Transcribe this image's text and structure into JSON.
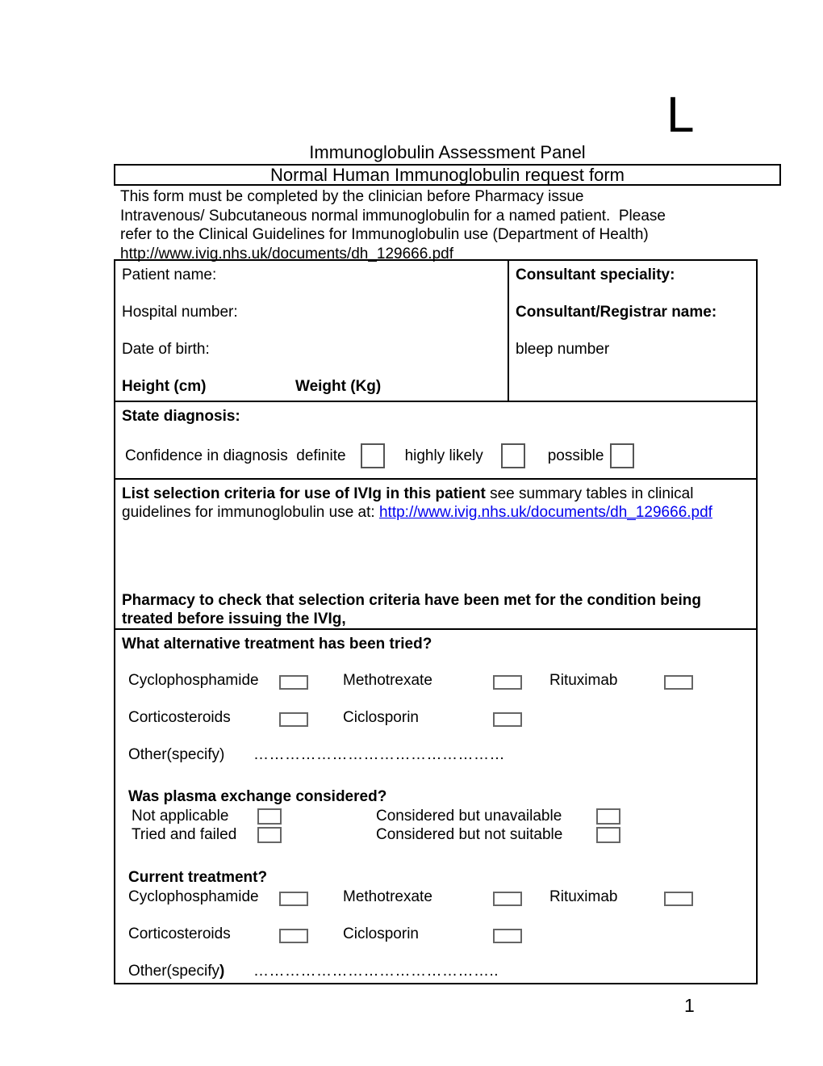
{
  "letterhead": {
    "mark": "L"
  },
  "header": {
    "panel_title": "Immunoglobulin Assessment Panel",
    "form_title": "Normal Human  Immunoglobulin request form"
  },
  "intro": {
    "line1": "This form must be completed by the clinician before Pharmacy issue",
    "line2": "Intravenous/ Subcutaneous normal immunoglobulin for a named patient.  Please",
    "line3": "refer to the Clinical Guidelines for Immunoglobulin use (Department of Health)",
    "line4": "http://www.ivig.nhs.uk/documents/dh_129666.pdf"
  },
  "patient": {
    "name_label": "Patient name:",
    "hospital_number_label": "Hospital number:",
    "date_of_birth_label": "Date of birth:",
    "height_label": "Height (cm)",
    "weight_label": "Weight (Kg)"
  },
  "consultant": {
    "speciality_label": "Consultant speciality:",
    "registrar_name_label": "Consultant/Registrar name:",
    "bleep_label": "bleep number"
  },
  "diagnosis": {
    "heading": "State diagnosis:",
    "confidence_label": "Confidence in diagnosis  definite",
    "option_highly_likely": "highly likely",
    "option_possible": "possible"
  },
  "criteria": {
    "bold_lead": "List selection criteria for use of IVIg in this patient",
    "rest": " see  summary tables in clinical guidelines for immunoglobulin use at: ",
    "link_text": "http://www.ivig.nhs.uk/documents/dh_129666.pdf",
    "link_color": "#0000ee",
    "pharmacy_note": "Pharmacy  to check that selection criteria have been met for the condition being treated before issuing the IVIg,"
  },
  "alternative_treatment": {
    "heading": "What alternative treatment has been tried?",
    "row1": [
      "Cyclophosphamide",
      "Methotrexate",
      "Rituximab"
    ],
    "row2": [
      "Corticosteroids",
      "Ciclosporin"
    ],
    "other_label": "Other(specify)",
    "other_dots": "…………………………………………"
  },
  "plasma_exchange": {
    "heading": "Was plasma exchange considered?",
    "not_applicable": "Not applicable",
    "tried_and_failed": "Tried and failed",
    "considered_unavailable": "Considered but unavailable",
    "considered_not_suitable": "Considered but not suitable"
  },
  "current_treatment": {
    "heading": "Current treatment?",
    "row1": [
      "Cyclophosphamide",
      "Methotrexate",
      "Rituximab"
    ],
    "row2": [
      "Corticosteroids",
      "Ciclosporin"
    ],
    "other_label_plain": "Other(specify",
    "other_label_bold": ")",
    "other_dots": "……………………………………….."
  },
  "footer": {
    "page_number": "1"
  }
}
